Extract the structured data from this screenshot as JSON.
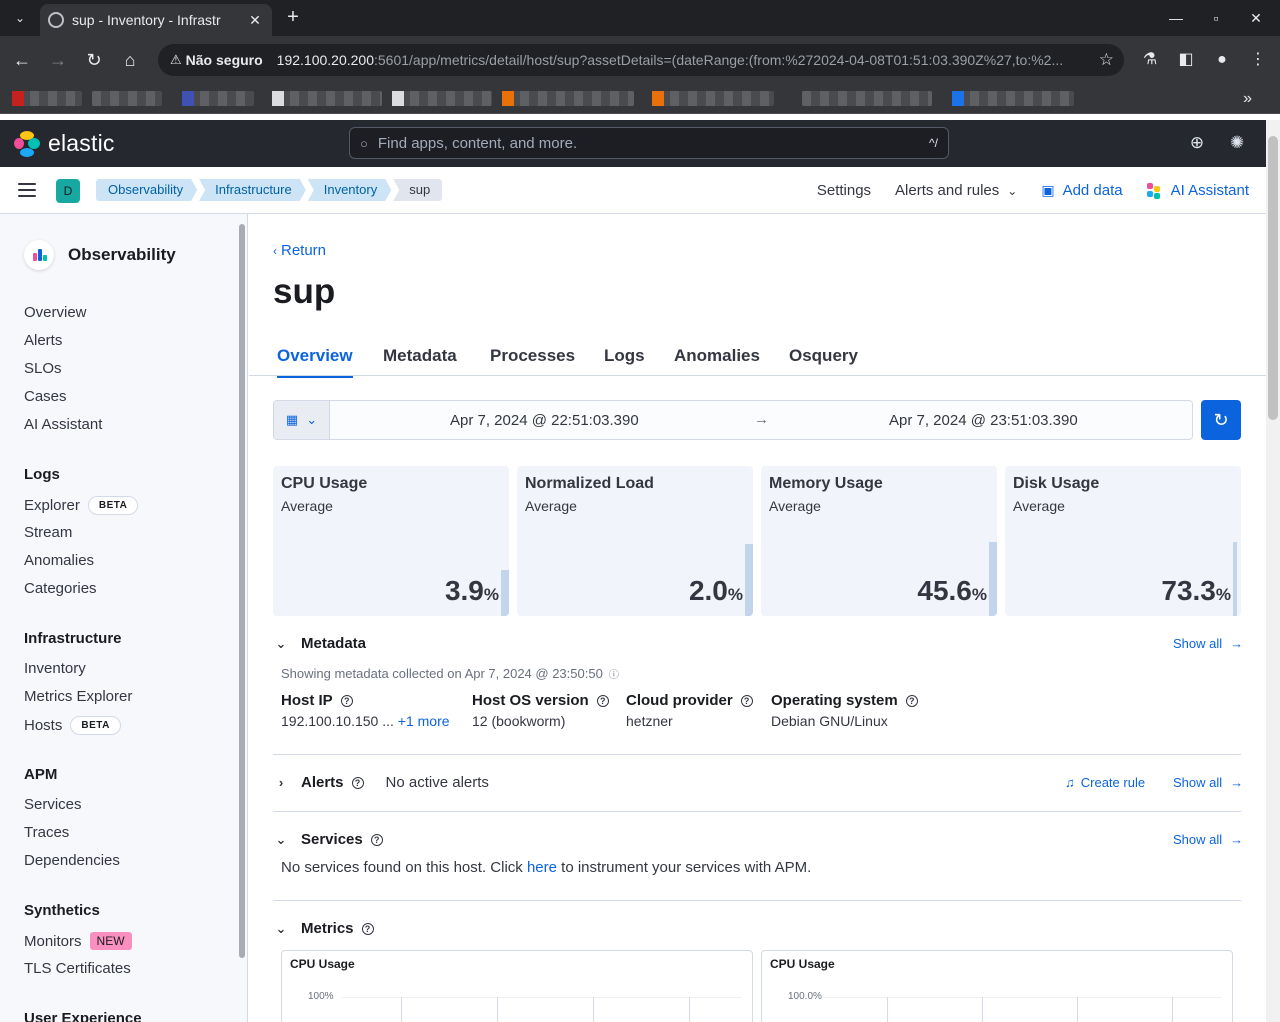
{
  "browser": {
    "tab_title": "sup - Inventory - Infrastr",
    "security_label": "Não seguro",
    "url_host": "192.100.20.200",
    "url_path": ":5601/app/metrics/detail/host/sup?assetDetails=(dateRange:(from:%272024-04-08T01:51:03.390Z%27,to:%2..."
  },
  "header": {
    "brand": "elastic",
    "search_placeholder": "Find apps, content, and more.",
    "search_shortcut": "^/"
  },
  "breadcrumbs": {
    "space_initial": "D",
    "items": [
      "Observability",
      "Infrastructure",
      "Inventory",
      "sup"
    ]
  },
  "header_links": {
    "settings": "Settings",
    "alerts_rules": "Alerts and rules",
    "add_data": "Add data",
    "ai_assistant": "AI Assistant"
  },
  "sidenav": {
    "title": "Observability",
    "items": [
      "Overview",
      "Alerts",
      "SLOs",
      "Cases",
      "AI Assistant"
    ],
    "groups": [
      {
        "title": "Logs",
        "items": [
          "Explorer",
          "Stream",
          "Anomalies",
          "Categories"
        ]
      },
      {
        "title": "Infrastructure",
        "items": [
          "Inventory",
          "Metrics Explorer",
          "Hosts"
        ]
      },
      {
        "title": "APM",
        "items": [
          "Services",
          "Traces",
          "Dependencies"
        ]
      },
      {
        "title": "Synthetics",
        "items": [
          "Monitors",
          "TLS Certificates"
        ]
      },
      {
        "title": "User Experience",
        "items": []
      }
    ],
    "badge_beta": "BETA",
    "badge_new": "NEW"
  },
  "page": {
    "return_label": "Return",
    "title": "sup",
    "tabs": [
      "Overview",
      "Metadata",
      "Processes",
      "Logs",
      "Anomalies",
      "Osquery"
    ],
    "date_start": "Apr 7, 2024 @ 22:51:03.390",
    "date_end": "Apr 7, 2024 @ 23:51:03.390",
    "kpis": [
      {
        "title": "CPU Usage",
        "subtitle": "Average",
        "value": "3.9",
        "unit": "%"
      },
      {
        "title": "Normalized Load",
        "subtitle": "Average",
        "value": "2.0",
        "unit": "%"
      },
      {
        "title": "Memory Usage",
        "subtitle": "Average",
        "value": "45.6",
        "unit": "%"
      },
      {
        "title": "Disk Usage",
        "subtitle": "Average",
        "value": "73.3",
        "unit": "%"
      }
    ],
    "metadata": {
      "title": "Metadata",
      "show_all": "Show all",
      "note": "Showing metadata collected on Apr 7, 2024 @ 23:50:50",
      "fields": [
        {
          "label": "Host IP",
          "value": "192.100.10.150 ...",
          "extra": "+1 more"
        },
        {
          "label": "Host OS version",
          "value": "12 (bookworm)"
        },
        {
          "label": "Cloud provider",
          "value": "hetzner"
        },
        {
          "label": "Operating system",
          "value": "Debian GNU/Linux"
        }
      ]
    },
    "alerts": {
      "title": "Alerts",
      "status": "No active alerts",
      "create_rule": "Create rule",
      "show_all": "Show all"
    },
    "services": {
      "title": "Services",
      "show_all": "Show all",
      "text_before": "No services found on this host. Click",
      "link": "here",
      "text_after": "to instrument your services with APM."
    },
    "metrics": {
      "title": "Metrics",
      "charts": [
        {
          "title": "CPU Usage",
          "ytick": "100%"
        },
        {
          "title": "CPU Usage",
          "ytick": "100.0%"
        }
      ]
    }
  }
}
